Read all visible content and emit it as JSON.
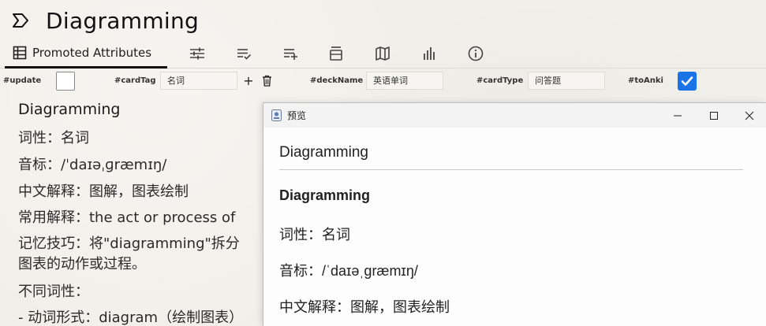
{
  "note": {
    "title": "Diagramming",
    "icon": "note-chevron-icon"
  },
  "ribbon": {
    "active_tab": "Promoted Attributes",
    "icons": [
      "table-icon",
      "sliders-icon",
      "checklist-icon",
      "playlist-add-icon",
      "panel-collapse-icon",
      "map-icon",
      "bar-chart-icon",
      "info-icon"
    ]
  },
  "attributes": {
    "update": {
      "label": "#update",
      "checked": false
    },
    "cardTag": {
      "label": "#cardTag",
      "value": "名词"
    },
    "deckName": {
      "label": "#deckName",
      "value": "英语单词"
    },
    "cardType": {
      "label": "#cardType",
      "value": "问答题"
    },
    "toAnki": {
      "label": "#toAnki",
      "checked": true
    },
    "add_label": "+",
    "delete_icon": "trash-icon"
  },
  "content": {
    "heading": "Diagramming",
    "line1": "词性：名词",
    "line2": "音标：/ˈdaɪəˌɡræmɪŋ/",
    "line3": "中文解释：图解，图表绘制",
    "line4": "常用解释：the act or process of",
    "line5": "记忆技巧：将\"diagramming\"拆分",
    "line6": "图表的动作或过程。",
    "line7": "不同词性：",
    "line8": "- 动词形式：diagram（绘制图表）"
  },
  "preview": {
    "window_title": "预览",
    "header": "Diagramming",
    "bold_title": "Diagramming",
    "line1": "词性：名词",
    "line2": "音标：/ˈdaɪəˌɡræmɪŋ/",
    "line3": "中文解释：图解，图表绘制"
  },
  "colors": {
    "accent": "#1b73e8",
    "background": "#f1efe9"
  }
}
